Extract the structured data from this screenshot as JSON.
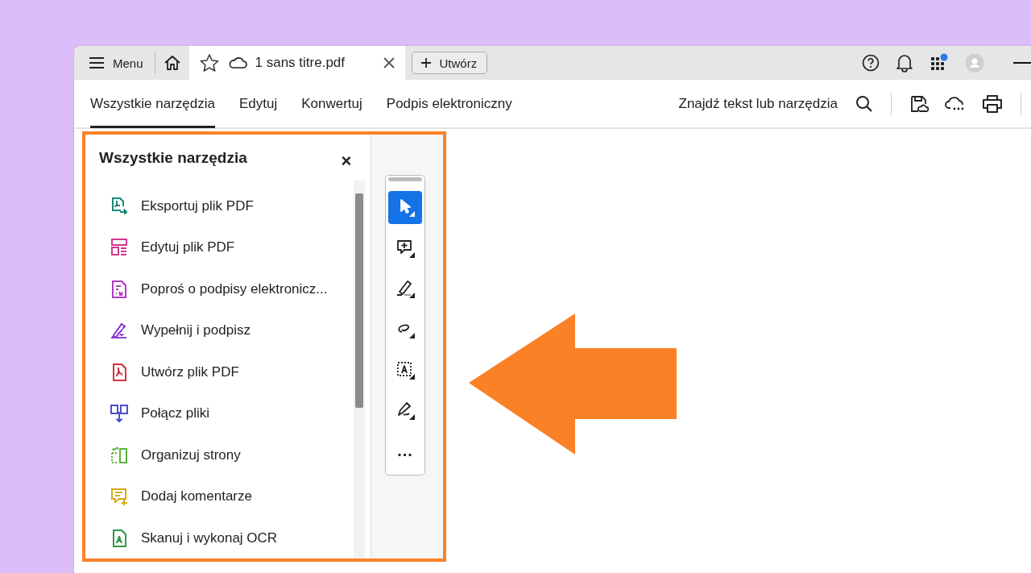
{
  "tab_bar": {
    "menu_label": "Menu",
    "document_tab": {
      "title": "1 sans titre.pdf",
      "selected": true
    },
    "create_button": "Utwórz",
    "apps_notification": true
  },
  "nav_tabs": [
    {
      "label": "Wszystkie narzędzia",
      "selected": true
    },
    {
      "label": "Edytuj",
      "selected": false
    },
    {
      "label": "Konwertuj",
      "selected": false
    },
    {
      "label": "Podpis elektroniczny",
      "selected": false
    }
  ],
  "search": {
    "label": "Znajdź tekst lub narzędzia"
  },
  "tools_panel": {
    "title": "Wszystkie narzędzia",
    "close": "×",
    "items": [
      {
        "label": "Eksportuj plik PDF",
        "kind": "export",
        "color": "#1a8a7a"
      },
      {
        "label": "Edytuj plik PDF",
        "kind": "edit",
        "color": "#d4358f"
      },
      {
        "label": "Poproś o podpisy elektronicz...",
        "kind": "request",
        "color": "#b03cc4"
      },
      {
        "label": "Wypełnij i podpisz",
        "kind": "sign",
        "color": "#8a3fd1"
      },
      {
        "label": "Utwórz plik PDF",
        "kind": "create",
        "color": "#d8323e"
      },
      {
        "label": "Połącz pliki",
        "kind": "combine",
        "color": "#4b4fd0"
      },
      {
        "label": "Organizuj strony",
        "kind": "organize",
        "color": "#5db33a"
      },
      {
        "label": "Dodaj komentarze",
        "kind": "comment",
        "color": "#d7a913"
      },
      {
        "label": "Skanuj i wykonaj OCR",
        "kind": "scan",
        "color": "#2e9a45"
      }
    ]
  },
  "quick_tools": [
    {
      "kind": "select",
      "selected": true
    },
    {
      "kind": "comment",
      "selected": false
    },
    {
      "kind": "highlight",
      "selected": false
    },
    {
      "kind": "draw",
      "selected": false
    },
    {
      "kind": "text",
      "selected": false
    },
    {
      "kind": "sign",
      "selected": false
    },
    {
      "kind": "more",
      "selected": false
    }
  ],
  "more_label": "..."
}
